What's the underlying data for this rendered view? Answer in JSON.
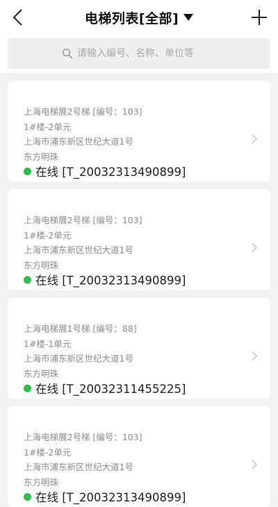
{
  "header": {
    "title": "电梯列表[全部]",
    "back_icon": "chevron-left-icon",
    "add_icon": "plus-icon",
    "dropdown_icon": "caret-down-icon"
  },
  "search": {
    "placeholder": "请输入编号、名称、单位等",
    "value": "",
    "icon": "search-icon"
  },
  "colors": {
    "online": "#2bbf4a",
    "background": "#f2f2f2",
    "card": "#ffffff"
  },
  "elevators": [
    {
      "name": "上海电梯展2号梯 [编号：103]",
      "building": "1#楼-2单元",
      "address": "上海市浦东新区世纪大道1号",
      "unit": "东方明珠",
      "status": "在线 [T_20032313490899]"
    },
    {
      "name": "上海电梯展2号梯 [编号：103]",
      "building": "1#楼-2单元",
      "address": "上海市浦东新区世纪大道1号",
      "unit": "东方明珠",
      "status": "在线 [T_20032313490899]"
    },
    {
      "name": "上海电梯展1号梯 [编号：88]",
      "building": "1#楼-1单元",
      "address": "上海市浦东新区世纪大道1号",
      "unit": "东方明珠",
      "status": "在线 [T_20032311455225]"
    },
    {
      "name": "上海电梯展2号梯 [编号：103]",
      "building": "1#楼-2单元",
      "address": "上海市浦东新区世纪大道1号",
      "unit": "东方明珠",
      "status": "在线 [T_20032313490899]"
    }
  ]
}
